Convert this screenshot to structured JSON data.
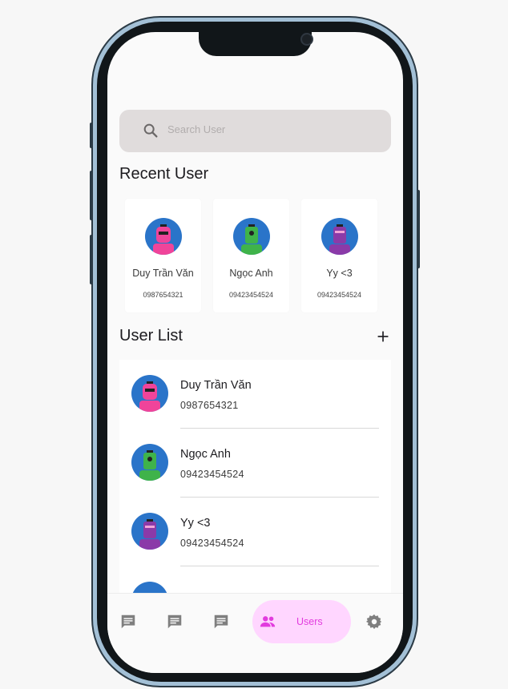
{
  "search": {
    "placeholder": "Search User",
    "icon": "search-icon"
  },
  "recent": {
    "title": "Recent User",
    "users": [
      {
        "name": "Duy Trần Văn",
        "phone": "0987654321",
        "robot_color": "#f0449a"
      },
      {
        "name": "Ngọc Anh",
        "phone": "09423454524",
        "robot_color": "#3fb34a"
      },
      {
        "name": "Yy <3",
        "phone": "09423454524",
        "robot_color": "#8b3aa8"
      }
    ]
  },
  "user_list": {
    "title": "User List",
    "add_icon": "plus-icon",
    "users": [
      {
        "name": "Duy Trần Văn",
        "phone": "0987654321",
        "robot_color": "#f0449a"
      },
      {
        "name": "Ngọc Anh",
        "phone": "09423454524",
        "robot_color": "#3fb34a"
      },
      {
        "name": "Yy <3",
        "phone": "09423454524",
        "robot_color": "#8b3aa8"
      }
    ]
  },
  "nav": {
    "items": [
      {
        "icon": "chat-icon"
      },
      {
        "icon": "chat-icon"
      },
      {
        "icon": "chat-icon"
      },
      {
        "icon": "people-icon",
        "label": "Users",
        "active": true
      },
      {
        "icon": "gear-icon"
      }
    ],
    "active_color": "#e23bde",
    "active_bg": "#ffd6ff"
  },
  "colors": {
    "avatar_bg": "#2a74c9",
    "inactive_icon": "#7f7f7f"
  }
}
